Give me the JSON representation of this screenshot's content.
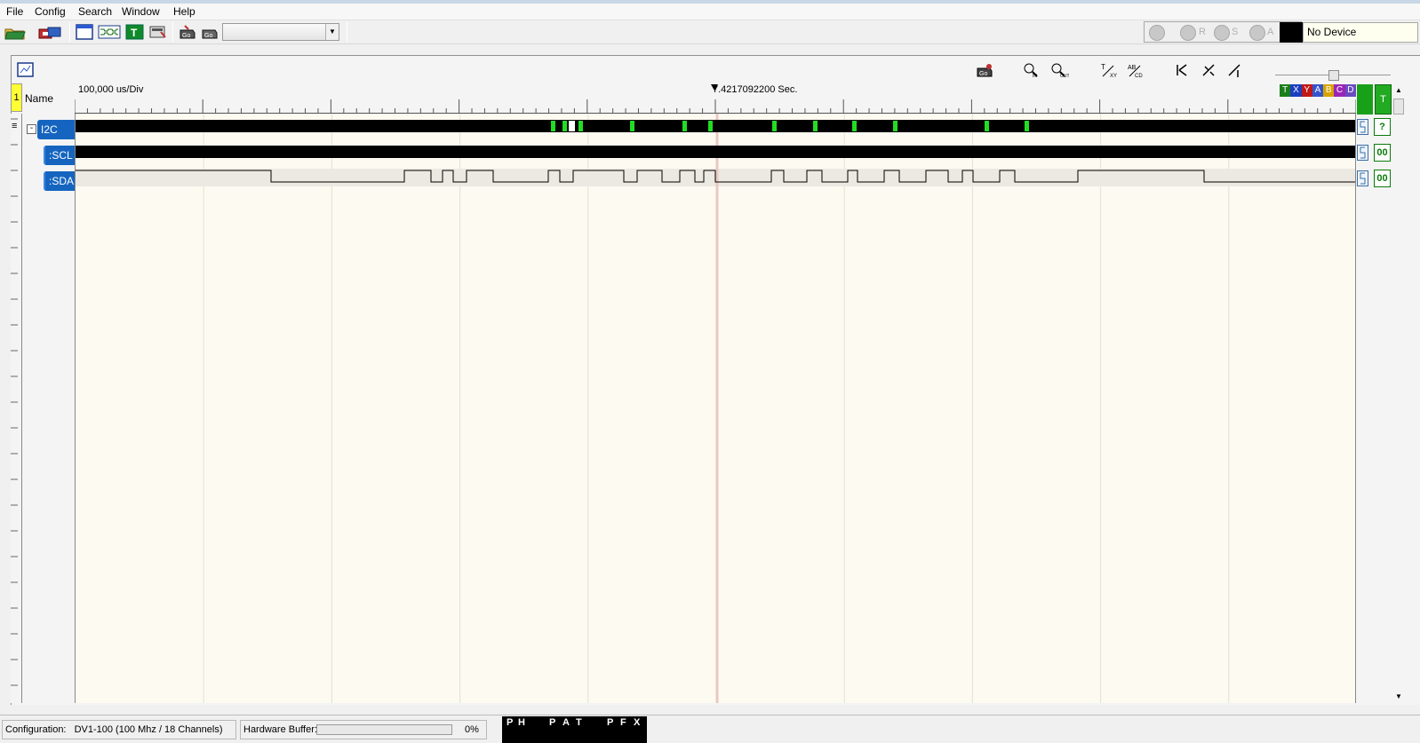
{
  "menu": {
    "items": [
      "File",
      "Config",
      "Search",
      "Window",
      "Help"
    ]
  },
  "toolbar": {
    "icons": [
      "open-folder-icon",
      "capture-device-icon",
      "window-icon",
      "bus-icon",
      "trigger-t-icon",
      "settings-icon",
      "capture-icon",
      "capture-options-icon"
    ],
    "combo_value": ""
  },
  "run_controls": {
    "r_label": "R",
    "s_label": "S",
    "a_label": "A"
  },
  "device": {
    "label": "No Device"
  },
  "display": {
    "row_number": "1",
    "name_header": "Name",
    "time_per_div": "100,000 us/Div",
    "cursor_time": "7.4217092200 Sec.",
    "legend": [
      "T",
      "X",
      "Y",
      "A",
      "B",
      "C",
      "D"
    ],
    "legend_colors": [
      "#1a7f1a",
      "#1c3fbf",
      "#c01818",
      "#3355cc",
      "#d7a300",
      "#9b25b8",
      "#6a4cc0"
    ],
    "t_button": "T",
    "header_icons": [
      "snapshot-icon",
      "zoom-in-icon",
      "zoom-out-icon",
      "cursor-xy-icon",
      "cursor-abcd-icon",
      "goto-start-icon",
      "goto-cursor-icon",
      "goto-end-icon"
    ]
  },
  "channels": [
    {
      "name": "I2C",
      "kind": "bus",
      "value": "?"
    },
    {
      "name": ":SCL",
      "kind": "clock",
      "value": "00"
    },
    {
      "name": ":SDA",
      "kind": "data",
      "value": "00"
    }
  ],
  "status": {
    "config_label": "Configuration:",
    "config_value": "DV1-100 (100 Mhz / 18 Channels)",
    "buffer_label": "Hardware Buffer:",
    "buffer_percent": "0%",
    "buffer_fill": 0,
    "pattern_letters": [
      "P",
      "H",
      "P",
      "A",
      "T",
      "P",
      "F",
      "X"
    ]
  },
  "colors": {
    "waveform_bg": "#fdfaf1",
    "channel_tag": "#1565c0",
    "bus_marker": "#22dd22",
    "cursor_line": "#e8c8c0"
  }
}
